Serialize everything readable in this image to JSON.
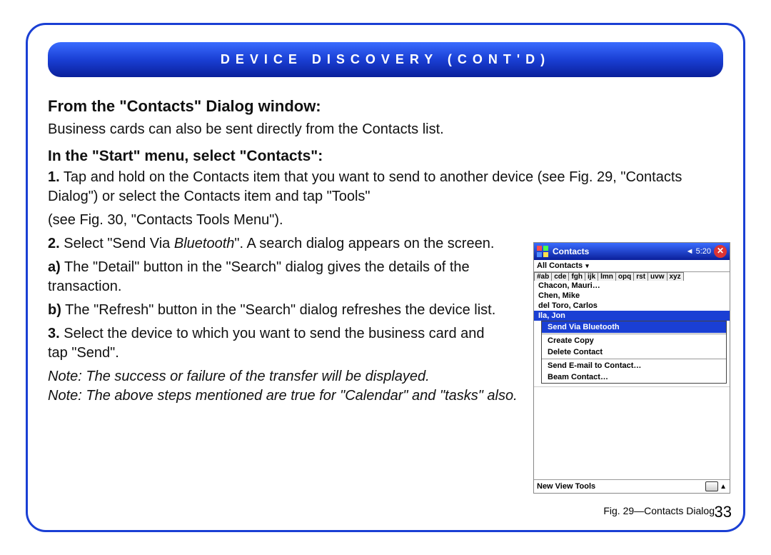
{
  "header": "DEVICE DISCOVERY (CONT'D)",
  "h1": "From the \"Contacts\" Dialog window:",
  "p1": "Business cards can also be sent directly from the Contacts list.",
  "h2": "In the \"Start\" menu, select \"Contacts\":",
  "s1_num": "1.",
  "s1_a": " Tap and hold on the Contacts item that you want to send to another device (see Fig. 29, \"Contacts Dialog\") or select the Contacts item and tap \"Tools\"",
  "s1_b": "(see Fig. 30, \"Contacts Tools Menu\").",
  "s2_num": "2.",
  "s2_a": " Select \"Send Via ",
  "s2_it": "Bluetooth",
  "s2_b": "\". A search dialog appears on the screen.",
  "sa_num": "a)",
  "sa": " The \"Detail\" button in the \"Search\" dialog gives the details of the transaction.",
  "sb_num": "b)",
  "sb": " The \"Refresh\" button in the \"Search\" dialog refreshes the device list.",
  "s3_num": "3.",
  "s3": " Select the device to which you want to send the business card and tap \"Send\".",
  "note1": "Note: The success or failure of the transfer will be displayed.",
  "note2": "Note: The above steps mentioned are true for \"Calendar\" and \"tasks\" also.",
  "fig_caption": "Fig. 29—Contacts Dialog",
  "page_number": "33",
  "device": {
    "title": "Contacts",
    "clock": "◄ 5:20",
    "filter": "All Contacts",
    "tabs": [
      "#ab",
      "cde",
      "fgh",
      "ijk",
      "lmn",
      "opq",
      "rst",
      "uvw",
      "xyz"
    ],
    "contacts": [
      "Chacon, Mauri…",
      "Chen, Mike",
      "del Toro, Carlos",
      "Ila, Jon"
    ],
    "menu": {
      "hl": "Send Via Bluetooth",
      "i1": "Create Copy",
      "i2": "Delete Contact",
      "i3": "Send E-mail to Contact…",
      "i4": "Beam Contact…"
    },
    "footer": "New  View  Tools"
  }
}
